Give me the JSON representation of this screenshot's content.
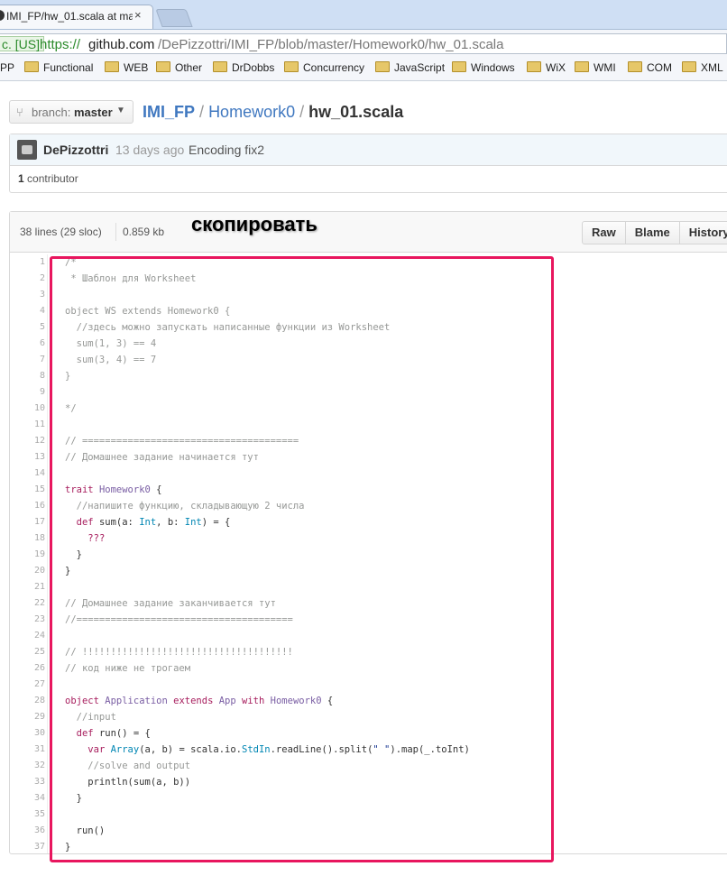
{
  "browser": {
    "tab_title": "IMI_FP/hw_01.scala at ma",
    "tab_close": "×",
    "security_badge": "c. [US]",
    "url_scheme": "https://",
    "url_host": "github.com",
    "url_path": "/DePizzottri/IMI_FP/blob/master/Homework0/hw_01.scala"
  },
  "bookmarks": [
    "PP",
    "Functional",
    "WEB",
    "Other",
    "DrDobbs",
    "Concurrency",
    "JavaScript",
    "Windows",
    "WiX",
    "WMI",
    "COM",
    "XML"
  ],
  "repo": {
    "branch_label": "branch:",
    "branch_name": "master",
    "crumb_repo": "IMI_FP",
    "crumb_sep1": "/",
    "crumb_dir": "Homework0",
    "crumb_sep2": "/",
    "crumb_file": "hw_01.scala"
  },
  "commit": {
    "author": "DePizzottri",
    "time": "13 days ago",
    "message": "Encoding fix2",
    "contributor_count": "1",
    "contributor_label": " contributor"
  },
  "file": {
    "lines_info": "38 lines (29 sloc)",
    "size": "0.859 kb",
    "buttons": [
      "Raw",
      "Blame",
      "History"
    ]
  },
  "annotation": "скопировать",
  "colors": {
    "link": "#4078c0",
    "comment": "#969896",
    "keyword": "#a71d5d",
    "type": "#795da3",
    "highlight_box": "#e8165e"
  },
  "code_lines": [
    "/*",
    " * Шаблон для Worksheet",
    "",
    "object WS extends Homework0 {",
    "  //здесь можно запускать написанные функции из Worksheet",
    "  sum(1, 3) == 4",
    "  sum(3, 4) == 7",
    "}",
    "",
    "*/",
    "",
    "// ======================================",
    "// Домашнее задание начинается тут",
    "",
    "trait Homework0 {",
    "  //напишите функцию, складывающую 2 числа",
    "  def sum(a: Int, b: Int) = {",
    "    ???",
    "  }",
    "}",
    "",
    "// Домашнее задание заканчивается тут",
    "//======================================",
    "",
    "// !!!!!!!!!!!!!!!!!!!!!!!!!!!!!!!!!!!!!",
    "// код ниже не трогаем",
    "",
    "object Application extends App with Homework0 {",
    "  //input",
    "  def run() = {",
    "    var Array(a, b) = scala.io.StdIn.readLine().split(\" \").map(_.toInt)",
    "    //solve and output",
    "    println(sum(a, b))",
    "  }",
    "",
    "  run()",
    "}"
  ]
}
